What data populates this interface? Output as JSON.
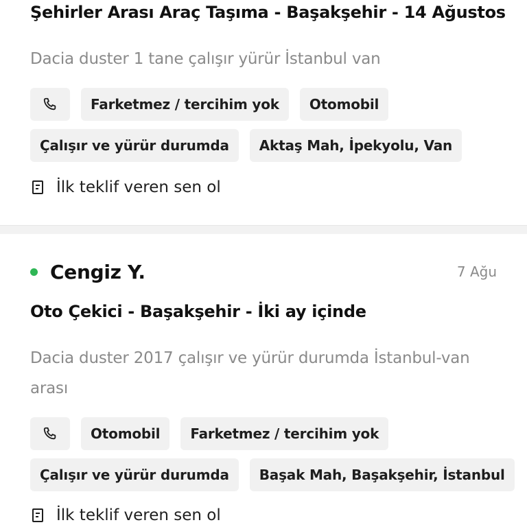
{
  "colors": {
    "online_dot": "#2fb655",
    "chip_bg": "#f1f1f1",
    "muted_text": "#8a8a8a"
  },
  "listings": [
    {
      "title": "Şehirler Arası Araç Taşıma - Başakşehir - 14 Ağustos",
      "description": "Dacia duster 1 tane çalışır yürür İstanbul van",
      "phone_icon": "phone-icon",
      "chips_row_1": [
        "Farketmez / tercihim yok",
        "Otomobil"
      ],
      "chips_row_2": [
        "Çalışır ve yürür durumda",
        "Aktaş Mah, İpekyolu, Van"
      ],
      "offer_icon": "document-icon",
      "offer_text": "İlk teklif veren sen ol"
    },
    {
      "user_name": "Cengiz Y.",
      "online": true,
      "date": "7 Ağu",
      "title": "Oto Çekici - Başakşehir - İki ay içinde",
      "description": "Dacia duster 2017 çalışır ve yürür durumda İstanbul-van arası",
      "phone_icon": "phone-icon",
      "chips_row_1": [
        "Otomobil",
        "Farketmez / tercihim yok"
      ],
      "chips_row_2": [
        "Çalışır ve yürür durumda",
        "Başak Mah, Başakşehir, İstanbul"
      ],
      "offer_icon": "document-icon",
      "offer_text": "İlk teklif veren sen ol"
    }
  ]
}
